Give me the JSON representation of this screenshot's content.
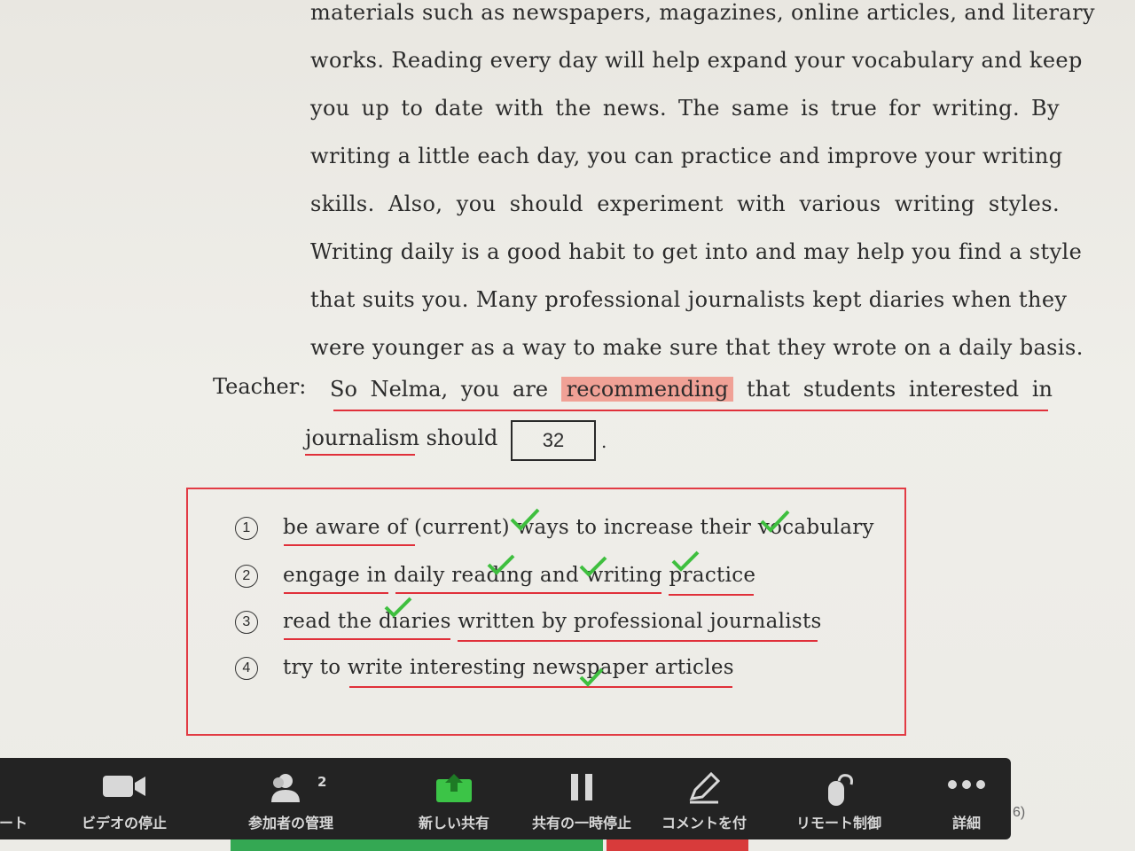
{
  "passage": {
    "lines": [
      "materials such as newspapers, magazines, online articles, and literary",
      "works.  Reading every day will help expand your vocabulary and keep",
      "you up to date with the news.  The same is true for writing.  By",
      "writing a little each day, you can practice and improve your writing",
      "skills.  Also, you should experiment with various writing styles.",
      "Writing daily is a good habit to get into and may help you find a style",
      "that suits you.  Many professional journalists kept diaries when they",
      "were younger as a way to make sure that they wrote on a daily basis."
    ]
  },
  "teacher": {
    "label": "Teacher:",
    "pre": [
      "So",
      "Nelma,",
      "you",
      "are"
    ],
    "highlight": "recommending",
    "post": [
      "that",
      "students",
      "interested",
      "in"
    ],
    "line2": "journalism should",
    "answer_number": "32",
    "period": "."
  },
  "options": [
    {
      "num": "1",
      "text": "be aware of (current) ways to increase their vocabulary"
    },
    {
      "num": "2",
      "text": "engage in daily reading and writing practice"
    },
    {
      "num": "3",
      "text": "read the diaries written by professional journalists"
    },
    {
      "num": "4",
      "text": "try to write interesting newspaper articles"
    }
  ],
  "toolbar": {
    "items": [
      {
        "label": "ート",
        "icon": "mute-icon"
      },
      {
        "label": "ビデオの停止",
        "icon": "video-camera-icon"
      },
      {
        "label": "参加者の管理",
        "icon": "participants-icon",
        "badge": "2"
      },
      {
        "label": "新しい共有",
        "icon": "share-screen-icon"
      },
      {
        "label": "共有の一時停止",
        "icon": "pause-icon"
      },
      {
        "label": "コメントを付",
        "icon": "annotate-pencil-icon"
      },
      {
        "label": "リモート制御",
        "icon": "remote-control-mouse-icon"
      },
      {
        "label": "詳細",
        "icon": "more-icon"
      }
    ],
    "side_text": "6)"
  },
  "colors": {
    "highlight": "#f0a196",
    "underline": "#e0303a",
    "check": "#3fbf3f",
    "toolbar": "#232323",
    "share": "#34a853"
  }
}
